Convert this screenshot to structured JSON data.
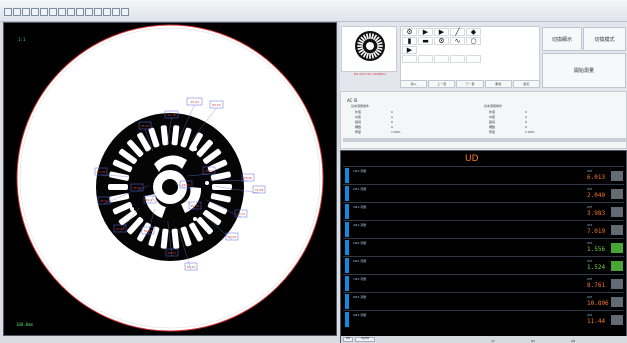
{
  "viewer": {
    "top_label": "1:1",
    "bottom_label": "100.0mm",
    "measurement_labels": [
      "35.94",
      "82.50",
      "45.76",
      "28.36",
      "63.68",
      "36.40",
      "48.81",
      "40.53",
      "50.05",
      "58.67",
      "60.22",
      "30.42",
      "33.01",
      "74.64",
      "38.96",
      "69.27",
      "27.30",
      "26.20",
      "35.00"
    ]
  },
  "right_panel": {
    "thumbnail_caption": "DS-Q0.0 50-12468(1)",
    "action_buttons": [
      "導入",
      "上一頁",
      "下一頁",
      "刪除",
      "確定"
    ],
    "big_buttons": [
      "切換顯示",
      "切換模式",
      "開始測量"
    ],
    "param_title": "AC IS",
    "params_left_header": "基本測量條件",
    "params_right_header": "基本測量條件",
    "params_rows_left": [
      [
        "外徑",
        "0"
      ],
      [
        "內徑",
        "0"
      ],
      [
        "鍵寬",
        "0"
      ],
      [
        "槽數",
        "0"
      ],
      [
        "厚度",
        "1.00%"
      ]
    ],
    "params_rows_right": [
      [
        "外徑",
        "0"
      ],
      [
        "內徑",
        "0"
      ],
      [
        "鍵寬",
        "0"
      ],
      [
        "槽數",
        "0"
      ],
      [
        "厚度",
        "1.00%"
      ]
    ]
  },
  "measurement": {
    "header": "UD",
    "rows": [
      {
        "label": "1#1-測量",
        "small": "OM",
        "value": "6.013",
        "color": "#f3792a"
      },
      {
        "label": "2#1-測量",
        "small": "OM",
        "value": "2.040",
        "color": "#f3792a"
      },
      {
        "label": "3#1-測量",
        "small": "OM",
        "value": "3.983",
        "color": "#f3792a"
      },
      {
        "label": "4#1-測量",
        "small": "OM",
        "value": "7.019",
        "color": "#f3792a"
      },
      {
        "label": "5#2-測量",
        "small": "OM",
        "value": "1.556",
        "color": "#74d544"
      },
      {
        "label": "6#2-測量",
        "small": "OM",
        "value": "1.524",
        "color": "#74d544"
      },
      {
        "label": "7#2-測量",
        "small": "OM",
        "value": "8.761",
        "color": "#f3792a"
      },
      {
        "label": "8#3-測量",
        "small": "OM",
        "value": "10.806",
        "color": "#f3792a"
      },
      {
        "label": "9#3-測量",
        "small": "OM",
        "value": "11.44",
        "color": "#f3792a"
      }
    ]
  },
  "footer": {
    "tabs": [
      "結果",
      "測量結果"
    ],
    "status_texts": [
      "文件",
      "模式",
      "設備"
    ]
  }
}
